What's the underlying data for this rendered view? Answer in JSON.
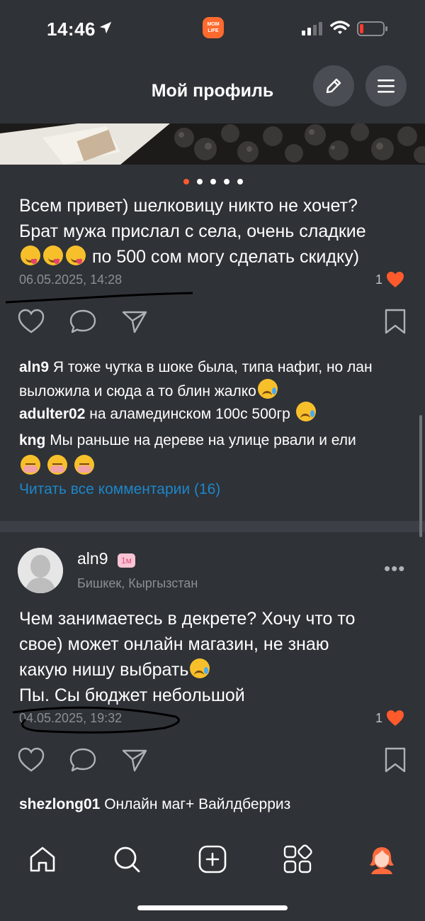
{
  "status_bar": {
    "time": "14:46",
    "app_badge": "MOM LIFE"
  },
  "header": {
    "title": "Мой профиль"
  },
  "carousel": {
    "dot_count": 5,
    "active_index": 0
  },
  "post1": {
    "text_line1": "Всем привет) шелковицу никто не хочет?",
    "text_line2": "Брат мужа прислал с села, очень сладкие",
    "text_line3": "по 500 сом могу сделать скидку)",
    "date": "06.05.2025, 14:28",
    "likes": "1",
    "comments": [
      {
        "user": "aln9",
        "text": "Я тоже чутка в шоке была, типа нафиг, но лан выложила и сюда а то блин жалко"
      },
      {
        "user": "adulter02",
        "text": "на аламединском 100с 500гр"
      },
      {
        "user": "kng",
        "text": "Мы раньше на дереве на улице рвали и ели"
      }
    ],
    "read_all": "Читать все комментарии (16)"
  },
  "post2": {
    "author": "aln9",
    "badge": "1м",
    "location": "Бишкек, Кыргызстан",
    "more": "•••",
    "text_line1": "Чем занимаетесь  в декрете? Хочу что то",
    "text_line2": "свое) может онлайн магазин, не знаю",
    "text_line3": "какую нишу выбрать",
    "text_line4": "Пы. Сы бюджет небольшой",
    "date": "04.05.2025, 19:32",
    "likes": "1",
    "comments": [
      {
        "user": "shezlong01",
        "text": "Онлайн маг+ Вайлдберриз"
      }
    ]
  },
  "nav": {
    "items": [
      "home-icon",
      "search-icon",
      "add-icon",
      "apps-icon",
      "profile-icon"
    ]
  },
  "colors": {
    "accent": "#ff5a2c",
    "link": "#1e86c9",
    "background": "#2f3237"
  }
}
